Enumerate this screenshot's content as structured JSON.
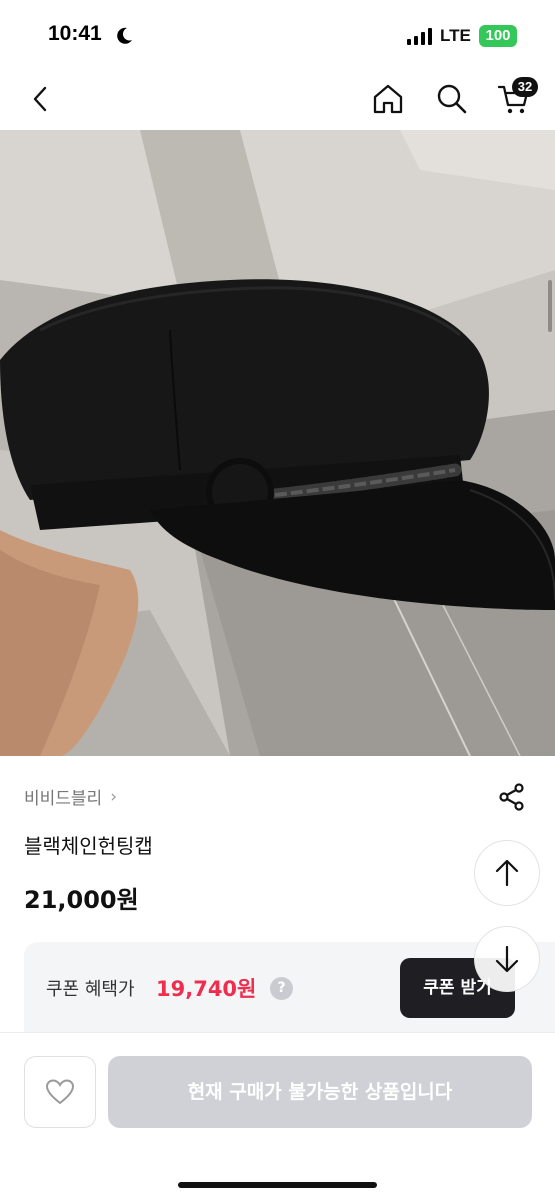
{
  "status_bar": {
    "time": "10:41",
    "network": "LTE",
    "battery": "100"
  },
  "nav": {
    "back_icon": "chevron-left-icon",
    "home_icon": "home-icon",
    "search_icon": "search-icon",
    "cart_icon": "cart-icon",
    "cart_count": "32"
  },
  "product": {
    "image_subject": "black chain newsboy cap",
    "brand": "비비드블리",
    "name": "블랙체인헌팅캡",
    "price": "21,000원"
  },
  "coupon": {
    "label": "쿠폰 혜택가",
    "price": "19,740원",
    "help": "?",
    "button": "쿠폰 받기"
  },
  "bottom": {
    "buy_status": "현재 구매가 불가능한 상품입니다"
  },
  "colors": {
    "accent_red": "#ef2d4f",
    "dark_button": "#1f1f23",
    "disabled_button": "#cfd1d6",
    "battery_green": "#34c759"
  }
}
